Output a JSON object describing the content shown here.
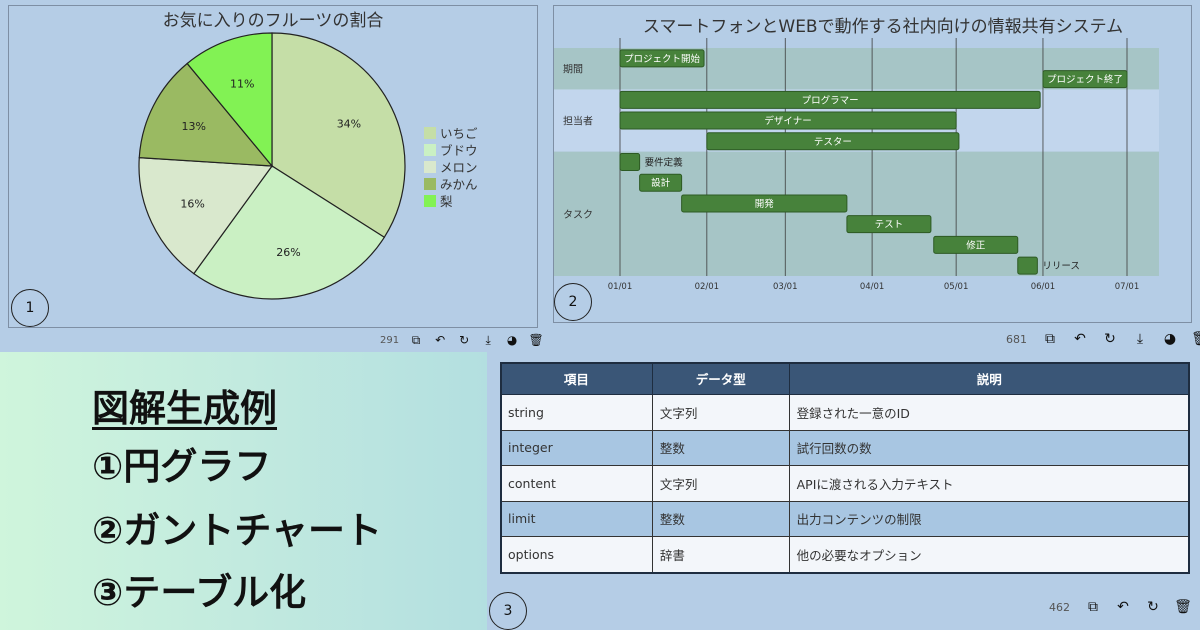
{
  "pie_panel": {
    "badge": "1",
    "toolbar_count": "291",
    "chart_data": {
      "type": "pie",
      "title": "お気に入りのフルーツの割合",
      "slices": [
        {
          "label": "いちご",
          "value": 34,
          "display": "34%",
          "color": "#c5dea7"
        },
        {
          "label": "ブドウ",
          "value": 26,
          "display": "26%",
          "color": "#caf0c3"
        },
        {
          "label": "メロン",
          "value": 16,
          "display": "16%",
          "color": "#d9e8cd"
        },
        {
          "label": "みかん",
          "value": 13,
          "display": "13%",
          "color": "#9aba62"
        },
        {
          "label": "梨",
          "value": 11,
          "display": "11%",
          "color": "#82f254"
        }
      ],
      "legend_placement": "right"
    }
  },
  "gantt_panel": {
    "badge": "2",
    "toolbar_count": "681",
    "chart_data": {
      "type": "gantt",
      "title": "スマートフォンとWEBで動作する社内向けの情報共有システム",
      "date_ticks": [
        "01/01",
        "02/01",
        "03/01",
        "04/01",
        "05/01",
        "06/01",
        "07/01"
      ],
      "sections": [
        {
          "name": "期間",
          "color": "#a6c5c6",
          "tasks": [
            {
              "label": "プロジェクト開始",
              "start": "01/01",
              "end": "01/31",
              "label_pos": "inside"
            },
            {
              "label": "プロジェクト終了",
              "start": "06/01",
              "end": "07/01",
              "label_pos": "inside"
            }
          ]
        },
        {
          "name": "担当者",
          "color": "#c2d6ed",
          "tasks": [
            {
              "label": "プログラマー",
              "start": "01/01",
              "end": "05/31",
              "label_pos": "inside"
            },
            {
              "label": "デザイナー",
              "start": "01/01",
              "end": "05/01",
              "label_pos": "inside"
            },
            {
              "label": "テスター",
              "start": "02/01",
              "end": "05/02",
              "label_pos": "inside"
            }
          ]
        },
        {
          "name": "タスク",
          "color": "#a6c5c6",
          "tasks": [
            {
              "label": "要件定義",
              "start": "01/01",
              "end": "01/08",
              "label_pos": "outside"
            },
            {
              "label": "設計",
              "start": "01/08",
              "end": "01/23",
              "label_pos": "inside"
            },
            {
              "label": "開発",
              "start": "01/23",
              "end": "03/23",
              "label_pos": "inside"
            },
            {
              "label": "テスト",
              "start": "03/23",
              "end": "04/22",
              "label_pos": "inside"
            },
            {
              "label": "修正",
              "start": "04/23",
              "end": "05/23",
              "label_pos": "inside"
            },
            {
              "label": "リリース",
              "start": "05/23",
              "end": "05/30",
              "label_pos": "outside"
            }
          ]
        }
      ]
    }
  },
  "hero": {
    "heading": "図解生成例",
    "lines": [
      "①円グラフ",
      "②ガントチャート",
      "③テーブル化"
    ]
  },
  "table_panel": {
    "badge": "3",
    "toolbar_count": "462",
    "headers": [
      "項目",
      "データ型",
      "説明"
    ],
    "rows": [
      [
        "string",
        "文字列",
        "登録された一意のID"
      ],
      [
        "integer",
        "整数",
        "試行回数の数"
      ],
      [
        "content",
        "文字列",
        "APIに渡される入力テキスト"
      ],
      [
        "limit",
        "整数",
        "出力コンテンツの制限"
      ],
      [
        "options",
        "辞書",
        "他の必要なオプション"
      ]
    ]
  },
  "icons": {
    "copy": "copy-icon",
    "undo": "undo-icon",
    "redo": "redo-icon",
    "download": "download-icon",
    "palette": "palette-icon",
    "trash": "trash-icon"
  },
  "colors": {
    "page_bg": "#b5cde6",
    "gantt_bar": "#47823b",
    "gantt_bar_border": "#2d5a24",
    "table_header": "#3a5677"
  }
}
